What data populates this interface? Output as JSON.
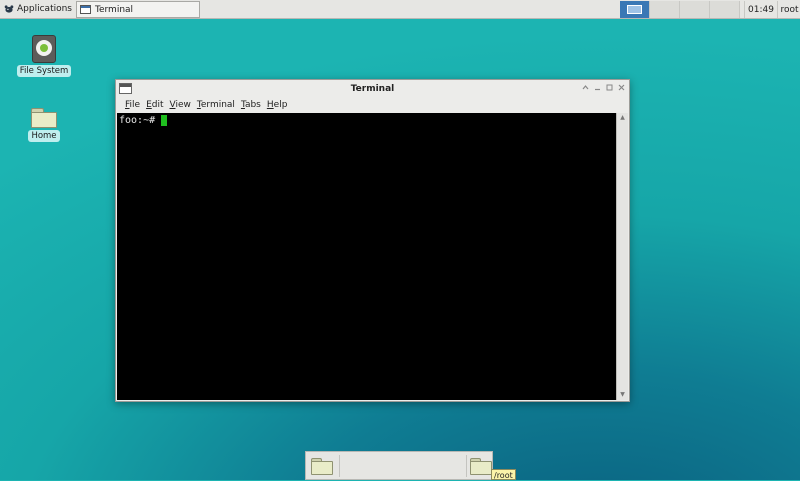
{
  "panel": {
    "applications_label": "Applications",
    "taskbar_item_label": "Terminal",
    "clock": "01:49",
    "user": "root",
    "workspace_count": 4
  },
  "desktop": {
    "icons": [
      {
        "label": "File System",
        "icon": "drive-icon"
      },
      {
        "label": "Home",
        "icon": "folder-icon"
      }
    ]
  },
  "window": {
    "title": "Terminal",
    "menus": [
      "File",
      "Edit",
      "View",
      "Terminal",
      "Tabs",
      "Help"
    ],
    "prompt": "foo:~#"
  },
  "dock": {
    "tooltip": "/root",
    "items": [
      "folder-icon",
      "folder-icon"
    ]
  },
  "colors": {
    "cursor": "#1fbf1f",
    "desktop_accent": "#16a6a8",
    "workspace_active": "#3a78b5"
  }
}
